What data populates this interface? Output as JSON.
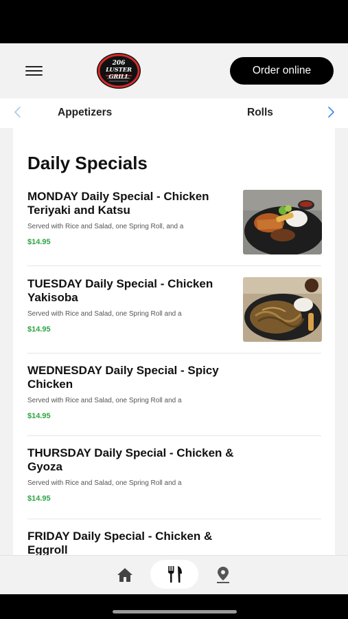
{
  "header": {
    "menu_icon": "hamburger-icon",
    "logo": {
      "line1": "206",
      "line2": "LUSTER GRILL"
    },
    "order_button": "Order online"
  },
  "tabs": {
    "left_arrow_icon": "chevron-left-icon",
    "right_arrow_icon": "chevron-right-icon",
    "items": [
      {
        "label": "Appetizers"
      },
      {
        "label": "Rolls"
      }
    ]
  },
  "section": {
    "title": "Daily Specials",
    "items": [
      {
        "name": "MONDAY Daily Special - Chicken Teriyaki and Katsu",
        "description": "Served with Rice and Salad, one Spring Roll, and a",
        "price": "$14.95"
      },
      {
        "name": "TUESDAY Daily Special - Chicken Yakisoba",
        "description": "Served with Rice and Salad, one Spring Roll and a",
        "price": "$14.95"
      },
      {
        "name": "WEDNESDAY Daily Special - Spicy Chicken",
        "description": "Served with Rice and Salad, one Spring Roll and a",
        "price": "$14.95"
      },
      {
        "name": "THURSDAY Daily Special - Chicken & Gyoza",
        "description": "Served with Rice and Salad, one Spring Roll and a",
        "price": "$14.95"
      },
      {
        "name": "FRIDAY Daily Special - Chicken & Eggroll"
      }
    ]
  },
  "bottom_nav": {
    "items": [
      {
        "icon": "home-icon"
      },
      {
        "icon": "fork-knife-icon",
        "active": true
      },
      {
        "icon": "map-pin-icon"
      }
    ]
  },
  "colors": {
    "accent": "#000000",
    "price": "#2ea443",
    "arrow": "#3b82f6",
    "logo_red": "#d62a2a"
  }
}
